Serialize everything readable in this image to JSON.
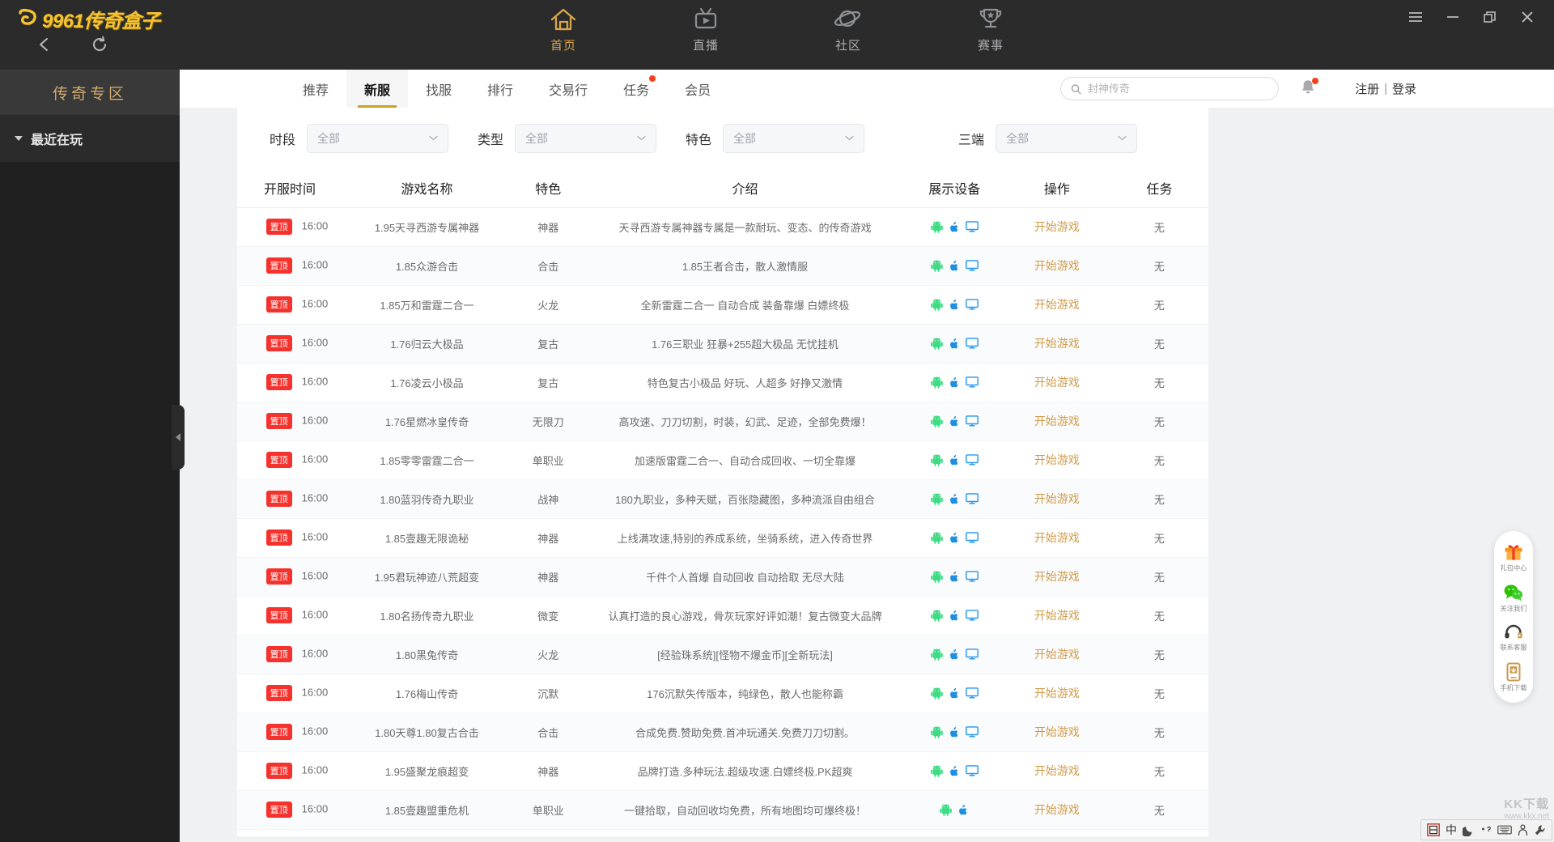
{
  "window": {
    "logo_text": "9961传奇盒子",
    "controls": [
      {
        "name": "menu",
        "glyph": "menu-icon"
      },
      {
        "name": "minimize",
        "glyph": "minimize-icon"
      },
      {
        "name": "maximize",
        "glyph": "maximize-icon"
      },
      {
        "name": "close",
        "glyph": "close-icon"
      }
    ],
    "back_icon": "back-arrow-icon",
    "refresh_icon": "refresh-icon"
  },
  "main_nav": [
    {
      "label": "首页",
      "icon": "home-icon",
      "active": true
    },
    {
      "label": "直播",
      "icon": "live-tv-icon",
      "active": false
    },
    {
      "label": "社区",
      "icon": "planet-icon",
      "active": false
    },
    {
      "label": "赛事",
      "icon": "trophy-icon",
      "active": false
    }
  ],
  "sidebar": {
    "title": "传奇专区",
    "section_label": "最近在玩"
  },
  "sub_nav": {
    "tabs": [
      {
        "label": "推荐",
        "active": false,
        "dot": false
      },
      {
        "label": "新服",
        "active": true,
        "dot": false
      },
      {
        "label": "找服",
        "active": false,
        "dot": false
      },
      {
        "label": "排行",
        "active": false,
        "dot": false
      },
      {
        "label": "交易行",
        "active": false,
        "dot": false
      },
      {
        "label": "任务",
        "active": false,
        "dot": true
      },
      {
        "label": "会员",
        "active": false,
        "dot": false
      }
    ],
    "search": {
      "placeholder": "封神传奇",
      "value": "",
      "icon": "search-icon"
    },
    "bell_icon": "bell-icon",
    "register_label": "注册",
    "separator": "|",
    "login_label": "登录"
  },
  "filters": [
    {
      "label": "时段",
      "value": "全部",
      "name": "time-range"
    },
    {
      "label": "类型",
      "value": "全部",
      "name": "type"
    },
    {
      "label": "特色",
      "value": "全部",
      "name": "feature"
    },
    {
      "label": "三端",
      "value": "全部",
      "name": "platform"
    }
  ],
  "table": {
    "headers": [
      "开服时间",
      "游戏名称",
      "特色",
      "介绍",
      "展示设备",
      "操作",
      "任务"
    ],
    "pin_badge": "置顶",
    "action_label": "开始游戏",
    "task_value": "无",
    "rows": [
      {
        "time": "16:00",
        "name": "1.95天寻西游专属神器",
        "feature": "神器",
        "intro": "天寻西游专属神器专属是一款耐玩、变态、的传奇游戏",
        "devices": [
          "android",
          "ios",
          "pc"
        ]
      },
      {
        "time": "16:00",
        "name": "1.85众游合击",
        "feature": "合击",
        "intro": "1.85王者合击，散人激情服",
        "devices": [
          "android",
          "ios",
          "pc"
        ]
      },
      {
        "time": "16:00",
        "name": "1.85万和雷霆二合一",
        "feature": "火龙",
        "intro": "全新雷霆二合一 自动合成 装备靠爆 白嫖终极",
        "devices": [
          "android",
          "ios",
          "pc"
        ]
      },
      {
        "time": "16:00",
        "name": "1.76归云大极品",
        "feature": "复古",
        "intro": "1.76三职业 狂暴+255超大极品 无忧挂机",
        "devices": [
          "android",
          "ios",
          "pc"
        ]
      },
      {
        "time": "16:00",
        "name": "1.76凌云小极品",
        "feature": "复古",
        "intro": "特色复古小极品 好玩、人超多 好挣又激情",
        "devices": [
          "android",
          "ios",
          "pc"
        ]
      },
      {
        "time": "16:00",
        "name": "1.76星燃冰皇传奇",
        "feature": "无限刀",
        "intro": "高攻速、刀刀切割，时装，幻武、足迹，全部免费爆！",
        "devices": [
          "android",
          "ios",
          "pc"
        ]
      },
      {
        "time": "16:00",
        "name": "1.85零零雷霆二合一",
        "feature": "单职业",
        "intro": "加速版雷霆二合一、自动合成回收、一切全靠爆",
        "devices": [
          "android",
          "ios",
          "pc"
        ]
      },
      {
        "time": "16:00",
        "name": "1.80蓝羽传奇九职业",
        "feature": "战神",
        "intro": "180九职业，多种天赋，百张隐藏图，多种流派自由组合",
        "devices": [
          "android",
          "ios",
          "pc"
        ]
      },
      {
        "time": "16:00",
        "name": "1.85壹趣无限诡秘",
        "feature": "神器",
        "intro": "上线满攻速,特别的养成系统，坐骑系统，进入传奇世界",
        "devices": [
          "android",
          "ios",
          "pc"
        ]
      },
      {
        "time": "16:00",
        "name": "1.95君玩神迹八荒超变",
        "feature": "神器",
        "intro": "千件个人首爆 自动回收 自动拾取 无尽大陆",
        "devices": [
          "android",
          "ios",
          "pc"
        ]
      },
      {
        "time": "16:00",
        "name": "1.80名扬传奇九职业",
        "feature": "微变",
        "intro": "认真打造的良心游戏，骨灰玩家好评如潮！复古微变大品牌",
        "devices": [
          "android",
          "ios",
          "pc"
        ]
      },
      {
        "time": "16:00",
        "name": "1.80黑兔传奇",
        "feature": "火龙",
        "intro": "[经验珠系统][怪物不爆金币][全新玩法]",
        "devices": [
          "android",
          "ios",
          "pc"
        ]
      },
      {
        "time": "16:00",
        "name": "1.76梅山传奇",
        "feature": "沉默",
        "intro": "176沉默失传版本，纯绿色，散人也能称霸",
        "devices": [
          "android",
          "ios",
          "pc"
        ]
      },
      {
        "time": "16:00",
        "name": "1.80天尊1.80复古合击",
        "feature": "合击",
        "intro": "合成免费.赞助免费.首冲玩通关.免费刀刀切割。",
        "devices": [
          "android",
          "ios",
          "pc"
        ]
      },
      {
        "time": "16:00",
        "name": "1.95盛聚龙痕超变",
        "feature": "神器",
        "intro": "品牌打造.多种玩法.超级攻速.白嫖终极.PK超爽",
        "devices": [
          "android",
          "ios",
          "pc"
        ]
      },
      {
        "time": "16:00",
        "name": "1.85壹趣盟重危机",
        "feature": "单职业",
        "intro": "一键拾取，自动回收均免费，所有地图均可爆终极！",
        "devices": [
          "android",
          "ios"
        ]
      }
    ]
  },
  "float_bar": [
    {
      "label": "礼包中心",
      "icon": "gift-icon"
    },
    {
      "label": "关注我们",
      "icon": "wechat-icon"
    },
    {
      "label": "联系客服",
      "icon": "headset-icon"
    },
    {
      "label": "手机下载",
      "icon": "phone-download-icon"
    }
  ],
  "tray": {
    "items": [
      "ime-logo-icon",
      "chinese-mode-label",
      "moon-icon",
      "punctuation-icon",
      "keyboard-icon",
      "person-icon",
      "wrench-icon"
    ],
    "chinese_label": "中"
  },
  "watermark": {
    "text": "KK下载",
    "sub": "www.kkx.net"
  },
  "colors": {
    "accent": "#c9a227",
    "badge_red": "#f5322d",
    "action_orange": "#d09b4a",
    "logo_yellow": "#f7c331",
    "sidebar_title": "#d2ab6d"
  }
}
